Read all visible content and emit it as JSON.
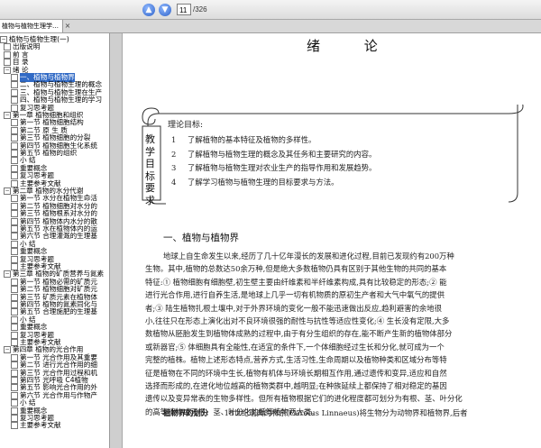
{
  "toolbar": {
    "page_current": "11",
    "page_total": "/326",
    "prev_icon": "up-arrow-icon",
    "next_icon": "down-arrow-icon"
  },
  "tab": {
    "label": "植物与植物生理学…",
    "close": "×"
  },
  "sidebar": {
    "items": [
      {
        "text": "植物与植物生理(一)",
        "level": 0,
        "toggle": "−"
      },
      {
        "text": "出版说明",
        "level": 1,
        "toggle": ""
      },
      {
        "text": "前 言",
        "level": 1,
        "toggle": ""
      },
      {
        "text": "目 录",
        "level": 1,
        "toggle": ""
      },
      {
        "text": "绪 论",
        "level": 1,
        "toggle": "−"
      },
      {
        "text": "一、植物与植物界",
        "level": 2,
        "toggle": "",
        "selected": true
      },
      {
        "text": "二、植物与植物生理的概念",
        "level": 2,
        "toggle": ""
      },
      {
        "text": "三、植物与植物生理在生产",
        "level": 2,
        "toggle": ""
      },
      {
        "text": "四、植物与植物生理的学习",
        "level": 2,
        "toggle": ""
      },
      {
        "text": "复习思考题",
        "level": 2,
        "toggle": ""
      },
      {
        "text": "第一章 植物细胞和组织",
        "level": 1,
        "toggle": "−"
      },
      {
        "text": "第一节 植物细胞结构",
        "level": 2,
        "toggle": ""
      },
      {
        "text": "第二节 原 生 质",
        "level": 2,
        "toggle": ""
      },
      {
        "text": "第三节 植物细胞的分裂",
        "level": 2,
        "toggle": ""
      },
      {
        "text": "第四节 植物细胞生化系统",
        "level": 2,
        "toggle": ""
      },
      {
        "text": "第五节 植物的组织",
        "level": 2,
        "toggle": ""
      },
      {
        "text": "小 结",
        "level": 2,
        "toggle": ""
      },
      {
        "text": "重要概念",
        "level": 2,
        "toggle": ""
      },
      {
        "text": "复习思考题",
        "level": 2,
        "toggle": ""
      },
      {
        "text": "主要参考文献",
        "level": 2,
        "toggle": ""
      },
      {
        "text": "第二章 植物的水分代谢",
        "level": 1,
        "toggle": "−"
      },
      {
        "text": "第一节 水分在植物生命活",
        "level": 2,
        "toggle": ""
      },
      {
        "text": "第二节 植物细胞对水分的",
        "level": 2,
        "toggle": ""
      },
      {
        "text": "第三节 植物根系对水分的",
        "level": 2,
        "toggle": ""
      },
      {
        "text": "第四节 植物体内水分的散",
        "level": 2,
        "toggle": ""
      },
      {
        "text": "第五节 水在植物体内的运",
        "level": 2,
        "toggle": ""
      },
      {
        "text": "第六节 合理灌溉的生理基",
        "level": 2,
        "toggle": ""
      },
      {
        "text": "小 结",
        "level": 2,
        "toggle": ""
      },
      {
        "text": "重要概念",
        "level": 2,
        "toggle": ""
      },
      {
        "text": "复习思考题",
        "level": 2,
        "toggle": ""
      },
      {
        "text": "主要参考文献",
        "level": 2,
        "toggle": ""
      },
      {
        "text": "第三章 植物的矿质营养与氮素",
        "level": 1,
        "toggle": "−"
      },
      {
        "text": "第一节 植物必需的矿质元",
        "level": 2,
        "toggle": ""
      },
      {
        "text": "第二节 植物细胞对矿质元",
        "level": 2,
        "toggle": ""
      },
      {
        "text": "第三节 矿质元素在植物体",
        "level": 2,
        "toggle": ""
      },
      {
        "text": "第四节 植物的氮素同化与",
        "level": 2,
        "toggle": ""
      },
      {
        "text": "第五节 合理施肥的生理基",
        "level": 2,
        "toggle": ""
      },
      {
        "text": "小 结",
        "level": 2,
        "toggle": ""
      },
      {
        "text": "重要概念",
        "level": 2,
        "toggle": ""
      },
      {
        "text": "复习思考题",
        "level": 2,
        "toggle": ""
      },
      {
        "text": "主要参考文献",
        "level": 2,
        "toggle": ""
      },
      {
        "text": "第四章 植物的光合作用",
        "level": 1,
        "toggle": "−"
      },
      {
        "text": "第一节 光合作用及其重要",
        "level": 2,
        "toggle": ""
      },
      {
        "text": "第二节 进行光合作用的细",
        "level": 2,
        "toggle": ""
      },
      {
        "text": "第三节 光合作用过程和机",
        "level": 2,
        "toggle": ""
      },
      {
        "text": "第四节 光呼吸 C4植物",
        "level": 2,
        "toggle": ""
      },
      {
        "text": "第五节 影响光合作用的外",
        "level": 2,
        "toggle": ""
      },
      {
        "text": "第六节 光合作用与作物产",
        "level": 2,
        "toggle": ""
      },
      {
        "text": "小 结",
        "level": 2,
        "toggle": ""
      },
      {
        "text": "重要概念",
        "level": 2,
        "toggle": ""
      },
      {
        "text": "复习思考题",
        "level": 2,
        "toggle": ""
      },
      {
        "text": "主要参考文献",
        "level": 2,
        "toggle": ""
      }
    ]
  },
  "doc": {
    "title": "绪 论",
    "goal_side": "教学目标要求",
    "goal_head": "理论目标:",
    "goals": [
      {
        "num": "1",
        "text": "了解植物的基本特征及植物的多样性。"
      },
      {
        "num": "2",
        "text": "了解植物与植物生理的概念及其任务和主要研究的内容。"
      },
      {
        "num": "3",
        "text": "了解植物与植物生理对农业生产的指导作用和发展趋势。"
      },
      {
        "num": "4",
        "text": "了解学习植物与植物生理的目标要求与方法。"
      }
    ],
    "section_head": "一、植物与植物界",
    "para_lines": [
      "地球上自生命发生以来,经历了几十亿年漫长的发展和进化过程,目前已发现约有200万种",
      "生物。其中,植物的总数达50余万种,但是绝大多数植物仍具有区别于其他生物的共同的基本",
      "特征:① 植物细胞有细胞壁,初生壁主要由纤维素和半纤维素构成,具有比较稳定的形态;② 能",
      "进行光合作用,进行自养生活,是地球上几乎一切有机物质的原初生产者和大气中氧气的提供",
      "者;③ 陆生植物扎根土壤中,对于外界环境的变化一般不能迅速做出反应,趋利避害的余地很",
      "小,往往只在形态上演化出对不良环境很强的耐性与抗性等适应性变化;④ 生长没有定限,大多",
      "数植物从胚胎发生到植物体成熟的过程中,由于有分生组织的存在,能不断产生新的植物体部分",
      "或新器官;⑤ 体细胞具有全能性,在适宜的条件下,一个体细胞经过生长和分化,就可成为一个",
      "完整的植株。植物上述形态特点,营养方式,生活习性,生命周期以及植物种类和区域分布等特",
      "征是植物在不同的环境中生长,植物有机体与环境长期相互作用,通过遗传和变异,适应和自然",
      "选择而形成的,在进化地位越高的植物类群中,越明显;在种族延续上都保持了相对稳定的基因",
      "遗传以及变异常表的生物多样性。但所有植物根据它们的进化程度都可划分为有根、茎、叶分化",
      "的高等植物或无根、茎、叶分化的低等植物两大类。"
    ],
    "last_term": "植物界的划分",
    "last_text": "18世纪瑞典的林奈(Carolus Linnaeus)将生物分为动物界和植物界,后者"
  }
}
